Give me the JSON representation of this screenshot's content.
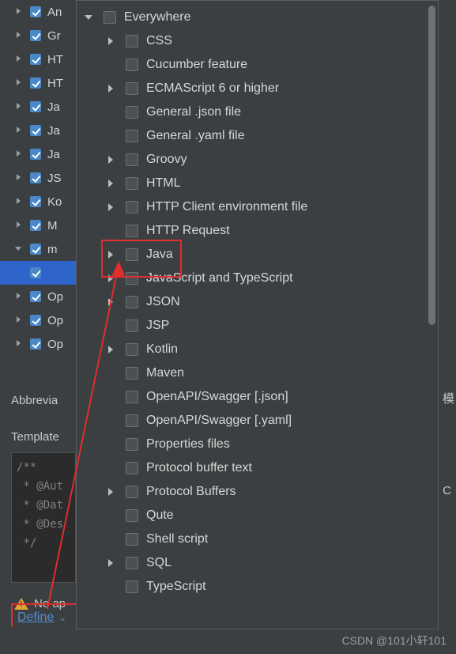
{
  "background_tree": {
    "rows": [
      {
        "arrow": "right",
        "checked": true,
        "label": "An",
        "selected": false
      },
      {
        "arrow": "right",
        "checked": true,
        "label": "Gr",
        "selected": false
      },
      {
        "arrow": "right",
        "checked": true,
        "label": "HT",
        "selected": false
      },
      {
        "arrow": "right",
        "checked": true,
        "label": "HT",
        "selected": false
      },
      {
        "arrow": "right",
        "checked": true,
        "label": "Ja",
        "selected": false
      },
      {
        "arrow": "right",
        "checked": true,
        "label": "Ja",
        "selected": false
      },
      {
        "arrow": "right",
        "checked": true,
        "label": "Ja",
        "selected": false
      },
      {
        "arrow": "right",
        "checked": true,
        "label": "JS",
        "selected": false
      },
      {
        "arrow": "right",
        "checked": true,
        "label": "Ko",
        "selected": false
      },
      {
        "arrow": "right",
        "checked": true,
        "label": "M",
        "selected": false
      },
      {
        "arrow": "down",
        "checked": true,
        "label": "m",
        "selected": false
      },
      {
        "arrow": "none",
        "checked": true,
        "label": "",
        "selected": true
      },
      {
        "arrow": "right",
        "checked": true,
        "label": "Op",
        "selected": false
      },
      {
        "arrow": "right",
        "checked": true,
        "label": "Op",
        "selected": false
      },
      {
        "arrow": "right",
        "checked": true,
        "label": "Op",
        "selected": false
      }
    ]
  },
  "form": {
    "abbreviation_label": "Abbrevia",
    "template_label": "Template",
    "template_text_lines": [
      "/**",
      " * @Aut",
      " * @Dat",
      " * @Des",
      " */"
    ],
    "warning_text": "No ap",
    "warning_icon": "warning-triangle-icon",
    "define_link": "Define",
    "define_chevron": "⌄"
  },
  "right_fragments": {
    "text_top": "模",
    "text_mid": "C"
  },
  "popup": {
    "scrollbar": "vertical-scrollbar",
    "items": [
      {
        "arrow": "down",
        "label": "Everywhere",
        "indent": 0
      },
      {
        "arrow": "right",
        "label": "CSS",
        "indent": 1
      },
      {
        "arrow": "none",
        "label": "Cucumber feature",
        "indent": 1
      },
      {
        "arrow": "right",
        "label": "ECMAScript 6 or higher",
        "indent": 1
      },
      {
        "arrow": "none",
        "label": "General .json file",
        "indent": 1
      },
      {
        "arrow": "none",
        "label": "General .yaml file",
        "indent": 1
      },
      {
        "arrow": "right",
        "label": "Groovy",
        "indent": 1
      },
      {
        "arrow": "right",
        "label": "HTML",
        "indent": 1
      },
      {
        "arrow": "right",
        "label": "HTTP Client environment file",
        "indent": 1
      },
      {
        "arrow": "none",
        "label": "HTTP Request",
        "indent": 1
      },
      {
        "arrow": "right",
        "label": "Java",
        "indent": 1
      },
      {
        "arrow": "right",
        "label": "JavaScript and TypeScript",
        "indent": 1
      },
      {
        "arrow": "right",
        "label": "JSON",
        "indent": 1
      },
      {
        "arrow": "none",
        "label": "JSP",
        "indent": 1
      },
      {
        "arrow": "right",
        "label": "Kotlin",
        "indent": 1
      },
      {
        "arrow": "none",
        "label": "Maven",
        "indent": 1
      },
      {
        "arrow": "none",
        "label": "OpenAPI/Swagger [.json]",
        "indent": 1
      },
      {
        "arrow": "none",
        "label": "OpenAPI/Swagger [.yaml]",
        "indent": 1
      },
      {
        "arrow": "none",
        "label": "Properties files",
        "indent": 1
      },
      {
        "arrow": "none",
        "label": "Protocol buffer text",
        "indent": 1
      },
      {
        "arrow": "right",
        "label": "Protocol Buffers",
        "indent": 1
      },
      {
        "arrow": "none",
        "label": "Qute",
        "indent": 1
      },
      {
        "arrow": "none",
        "label": "Shell script",
        "indent": 1
      },
      {
        "arrow": "right",
        "label": "SQL",
        "indent": 1
      },
      {
        "arrow": "none",
        "label": "TypeScript",
        "indent": 1
      }
    ]
  },
  "annotations": {
    "highlight_target": "Java",
    "highlight_color": "#e02d2d",
    "arrow_color": "#e02d2d"
  },
  "watermark": {
    "text": "CSDN @101小轩101"
  }
}
